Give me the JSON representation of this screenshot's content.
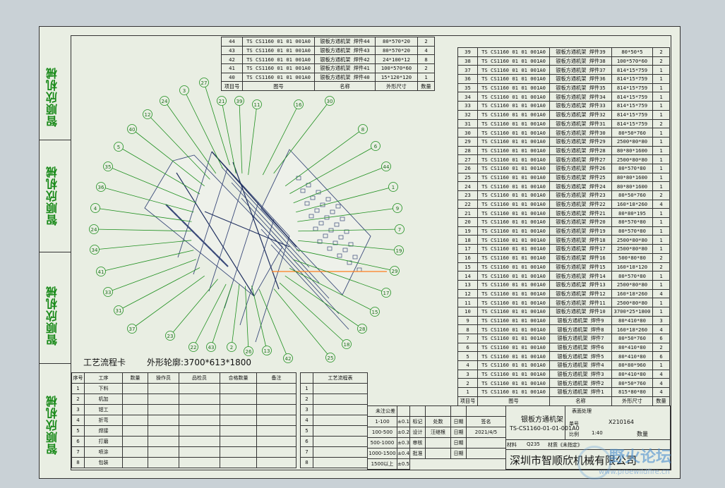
{
  "side_labels": [
    "智顺欣机械",
    "智顺欣机械",
    "智顺欣机械",
    "智顺欣机械"
  ],
  "bom_top": {
    "rows": [
      [
        "44",
        "TS CS1160 01 01 001A0",
        "银板方通机架 焊件44",
        "80*570*20",
        "2"
      ],
      [
        "43",
        "TS CS1160 01 01 001A0",
        "银板方通机架 焊件43",
        "80*570*20",
        "4"
      ],
      [
        "42",
        "TS CS1160 01 01 001A0",
        "银板方通机架 焊件42",
        "24*100*12",
        "8"
      ],
      [
        "41",
        "TS CS1160 01 01 001A0",
        "银板方通机架 焊件41",
        "100*570*60",
        "2"
      ],
      [
        "40",
        "TS CS1160 01 01 001A0",
        "银板方通机架 焊件40",
        "15*120*120",
        "1"
      ]
    ],
    "header": [
      "项目号",
      "图号",
      "名称",
      "外形尺寸",
      "数量"
    ]
  },
  "bom_right": {
    "rows": [
      [
        "39",
        "TS CS1160 01 01 001A0",
        "银板方通机架 焊件39",
        "80*50*5",
        "2"
      ],
      [
        "38",
        "TS CS1160 01 01 001A0",
        "银板方通机架 焊件38",
        "100*570*60",
        "2"
      ],
      [
        "37",
        "TS CS1160 01 01 001A0",
        "银板方通机架 焊件37",
        "814*15*759",
        "1"
      ],
      [
        "36",
        "TS CS1160 01 01 001A0",
        "银板方通机架 焊件36",
        "814*15*759",
        "1"
      ],
      [
        "35",
        "TS CS1160 01 01 001A0",
        "银板方通机架 焊件35",
        "814*15*759",
        "1"
      ],
      [
        "34",
        "TS CS1160 01 01 001A0",
        "银板方通机架 焊件34",
        "814*15*759",
        "1"
      ],
      [
        "33",
        "TS CS1160 01 01 001A0",
        "银板方通机架 焊件33",
        "814*15*759",
        "1"
      ],
      [
        "32",
        "TS CS1160 01 01 001A0",
        "银板方通机架 焊件32",
        "814*15*759",
        "1"
      ],
      [
        "31",
        "TS CS1160 01 01 001A0",
        "银板方通机架 焊件31",
        "814*15*759",
        "2"
      ],
      [
        "30",
        "TS CS1160 01 01 001A0",
        "银板方通机架 焊件30",
        "80*50*760",
        "1"
      ],
      [
        "29",
        "TS CS1160 01 01 001A0",
        "银板方通机架 焊件29",
        "2500*80*80",
        "1"
      ],
      [
        "28",
        "TS CS1160 01 01 001A0",
        "银板方通机架 焊件28",
        "80*80*1600",
        "1"
      ],
      [
        "27",
        "TS CS1160 01 01 001A0",
        "银板方通机架 焊件27",
        "2500*80*80",
        "1"
      ],
      [
        "26",
        "TS CS1160 01 01 001A0",
        "银板方通机架 焊件26",
        "80*570*80",
        "1"
      ],
      [
        "25",
        "TS CS1160 01 01 001A0",
        "银板方通机架 焊件25",
        "80*80*1600",
        "1"
      ],
      [
        "24",
        "TS CS1160 01 01 001A0",
        "银板方通机架 焊件24",
        "80*80*1600",
        "1"
      ],
      [
        "23",
        "TS CS1160 01 01 001A0",
        "银板方通机架 焊件23",
        "80*50*760",
        "2"
      ],
      [
        "22",
        "TS CS1160 01 01 001A0",
        "银板方通机架 焊件22",
        "160*18*260",
        "4"
      ],
      [
        "21",
        "TS CS1160 01 01 001A0",
        "银板方通机架 焊件21",
        "80*80*195",
        "1"
      ],
      [
        "20",
        "TS CS1160 01 01 001A0",
        "银板方通机架 焊件20",
        "80*570*80",
        "1"
      ],
      [
        "19",
        "TS CS1160 01 01 001A0",
        "银板方通机架 焊件19",
        "80*570*80",
        "1"
      ],
      [
        "18",
        "TS CS1160 01 01 001A0",
        "银板方通机架 焊件18",
        "2500*80*80",
        "1"
      ],
      [
        "17",
        "TS CS1160 01 01 001A0",
        "银板方通机架 焊件17",
        "2500*80*80",
        "1"
      ],
      [
        "16",
        "TS CS1160 01 01 001A0",
        "银板方通机架 焊件16",
        "500*80*80",
        "2"
      ],
      [
        "15",
        "TS CS1160 01 01 001A0",
        "银板方通机架 焊件15",
        "160*18*120",
        "2"
      ],
      [
        "14",
        "TS CS1160 01 01 001A0",
        "银板方通机架 焊件14",
        "80*570*80",
        "1"
      ],
      [
        "13",
        "TS CS1160 01 01 001A0",
        "银板方通机架 焊件13",
        "2500*80*80",
        "1"
      ],
      [
        "12",
        "TS CS1160 01 01 001A0",
        "银板方通机架 焊件12",
        "160*18*260",
        "4"
      ],
      [
        "11",
        "TS CS1160 01 01 001A0",
        "银板方通机架 焊件11",
        "2500*80*80",
        "1"
      ],
      [
        "10",
        "TS CS1160 01 01 001A0",
        "银板方通机架 焊件10",
        "3700*25*1800",
        "1"
      ],
      [
        "9",
        "TS CS1160 01 01 001A0",
        "银板方通机架 焊件9",
        "80*410*80",
        "3"
      ],
      [
        "8",
        "TS CS1160 01 01 001A0",
        "银板方通机架 焊件8",
        "160*18*260",
        "4"
      ],
      [
        "7",
        "TS CS1160 01 01 001A0",
        "银板方通机架 焊件7",
        "80*50*760",
        "6"
      ],
      [
        "6",
        "TS CS1160 01 01 001A0",
        "银板方通机架 焊件6",
        "80*410*80",
        "2"
      ],
      [
        "5",
        "TS CS1160 01 01 001A0",
        "银板方通机架 焊件5",
        "80*410*80",
        "6"
      ],
      [
        "4",
        "TS CS1160 01 01 001A0",
        "银板方通机架 焊件4",
        "80*80*960",
        "1"
      ],
      [
        "3",
        "TS CS1160 01 01 001A0",
        "银板方通机架 焊件3",
        "80*410*80",
        "4"
      ],
      [
        "2",
        "TS CS1160 01 01 001A0",
        "银板方通机架 焊件2",
        "80*50*760",
        "4"
      ],
      [
        "1",
        "TS CS1160 01 01 001A0",
        "银板方通机架 焊件1",
        "815*80*80",
        "4"
      ]
    ],
    "header": [
      "项目号",
      "图号",
      "名称",
      "外形尺寸",
      "数量"
    ]
  },
  "process_card": {
    "title": "工艺流程卡",
    "outline": "外形轮廓:3700*613*1800",
    "headers": [
      "序号",
      "工序",
      "数量",
      "操作员",
      "品检员",
      "合格数量",
      "备注"
    ],
    "rows": [
      [
        "1",
        "下料"
      ],
      [
        "2",
        "机加"
      ],
      [
        "3",
        "钳工"
      ],
      [
        "4",
        "折弯"
      ],
      [
        "5",
        "焊接"
      ],
      [
        "6",
        "打磨"
      ],
      [
        "7",
        "喷涂"
      ],
      [
        "8",
        "包装"
      ]
    ]
  },
  "process_card2": {
    "title": "工艺流程表",
    "rows": [
      "1",
      "2",
      "3",
      "4",
      "5",
      "6",
      "7",
      "8"
    ]
  },
  "title_block": {
    "tolerance_title": "未注公差",
    "tol_rows": [
      [
        "1-100",
        "±0.1"
      ],
      [
        "100-500",
        "±0.2"
      ],
      [
        "500-1000",
        "±0.3"
      ],
      [
        "1000-1500",
        "±0.4"
      ],
      [
        "1500以上",
        "±0.5"
      ]
    ],
    "sign_labels": [
      "标记",
      "设计",
      "审核",
      "批准"
    ],
    "names": [
      "处数",
      "汪继根"
    ],
    "date_label": "日期",
    "sign_label": "签名",
    "date_value": "2021/4/5",
    "material_label": "材料",
    "material_value": "Q235",
    "material2": "材质《未指定》",
    "part_title": "银板方通机架",
    "drawing_no": "TS-CS1160-01-01-001A0",
    "code_label": "单号",
    "code_value": "X210164",
    "ratio_label": "比例",
    "ratio_value": "1:40",
    "qty_label": "数量",
    "project_label": "表面处理",
    "company": "深圳市智顺欣机械有限公司",
    "stage_label": "共",
    "page_label": "第 页"
  },
  "balloons": [
    "27",
    "3",
    "21",
    "39",
    "11",
    "16",
    "30",
    "8",
    "6",
    "44",
    "1",
    "9",
    "7",
    "19",
    "29",
    "17",
    "15",
    "28",
    "18",
    "25",
    "42",
    "13",
    "26",
    "2",
    "43",
    "22",
    "23",
    "37",
    "31",
    "33",
    "41",
    "34",
    "24",
    "4",
    "36",
    "35",
    "5",
    "40",
    "12",
    "24"
  ],
  "watermark": {
    "title": "野火论坛",
    "url": "www.proewildfire.cn"
  },
  "colors": {
    "paper": "#e9eee3",
    "frame": "#333333",
    "leader": "#1e8f1e",
    "part": "#3a4a7a",
    "highlight": "#ff7f1f",
    "side": "#1a8a1a"
  }
}
